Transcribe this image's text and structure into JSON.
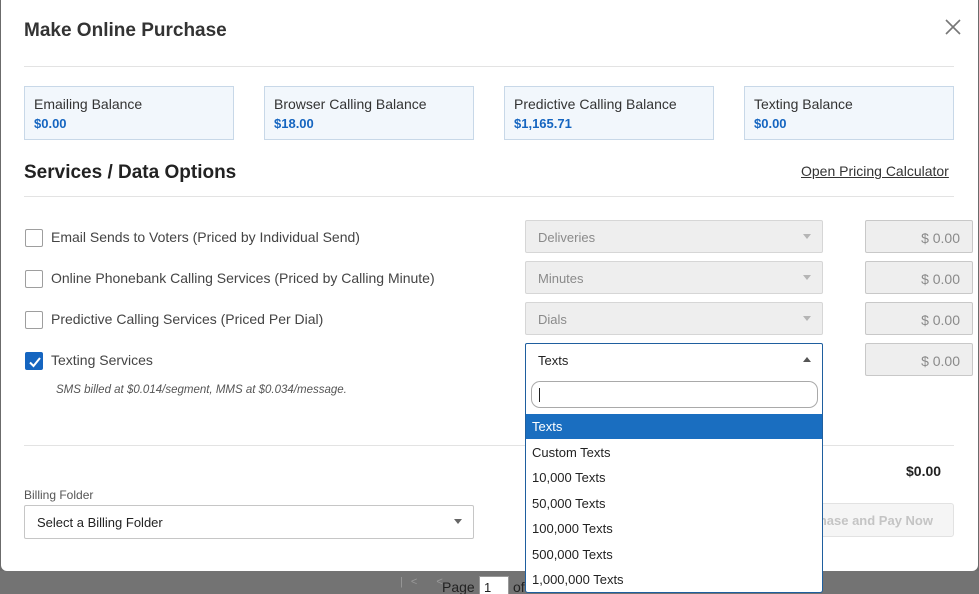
{
  "background_page": {
    "pagination": {
      "arrows": "|< <",
      "page_label": "Page",
      "page_value": "1",
      "of_label": "of"
    }
  },
  "modal": {
    "title": "Make Online Purchase",
    "balances": [
      {
        "label": "Emailing Balance",
        "value": "$0.00"
      },
      {
        "label": "Browser Calling Balance",
        "value": "$18.00"
      },
      {
        "label": "Predictive Calling Balance",
        "value": "$1,165.71"
      },
      {
        "label": "Texting Balance",
        "value": "$0.00"
      }
    ],
    "section_title": "Services / Data Options",
    "pricing_link": "Open Pricing Calculator",
    "services": [
      {
        "label": "Email Sends to Voters (Priced by Individual Send)",
        "checked": false,
        "select_value": "Deliveries",
        "amount": "$ 0.00"
      },
      {
        "label": "Online Phonebank Calling Services (Priced by Calling Minute)",
        "checked": false,
        "select_value": "Minutes",
        "amount": "$ 0.00"
      },
      {
        "label": "Predictive Calling Services (Priced Per Dial)",
        "checked": false,
        "select_value": "Dials",
        "amount": "$ 0.00"
      },
      {
        "label": "Texting Services",
        "checked": true,
        "select_value": "Texts",
        "amount": "$ 0.00"
      }
    ],
    "texting_note": "SMS billed at $0.014/segment, MMS at $0.034/message.",
    "billing": {
      "label": "Billing Folder",
      "placeholder": "Select a Billing Folder"
    },
    "total": "$0.00",
    "pay_button": "Purchase and Pay Now"
  },
  "dropdown": {
    "search_value": "",
    "selected_index": 0,
    "options": [
      "Texts",
      "Custom Texts",
      "10,000 Texts",
      "50,000 Texts",
      "100,000 Texts",
      "500,000 Texts",
      "1,000,000 Texts"
    ]
  },
  "colors": {
    "accent": "#1565c0",
    "selected_option": "#1a6ec0",
    "card_bg": "#f2f7fc"
  }
}
